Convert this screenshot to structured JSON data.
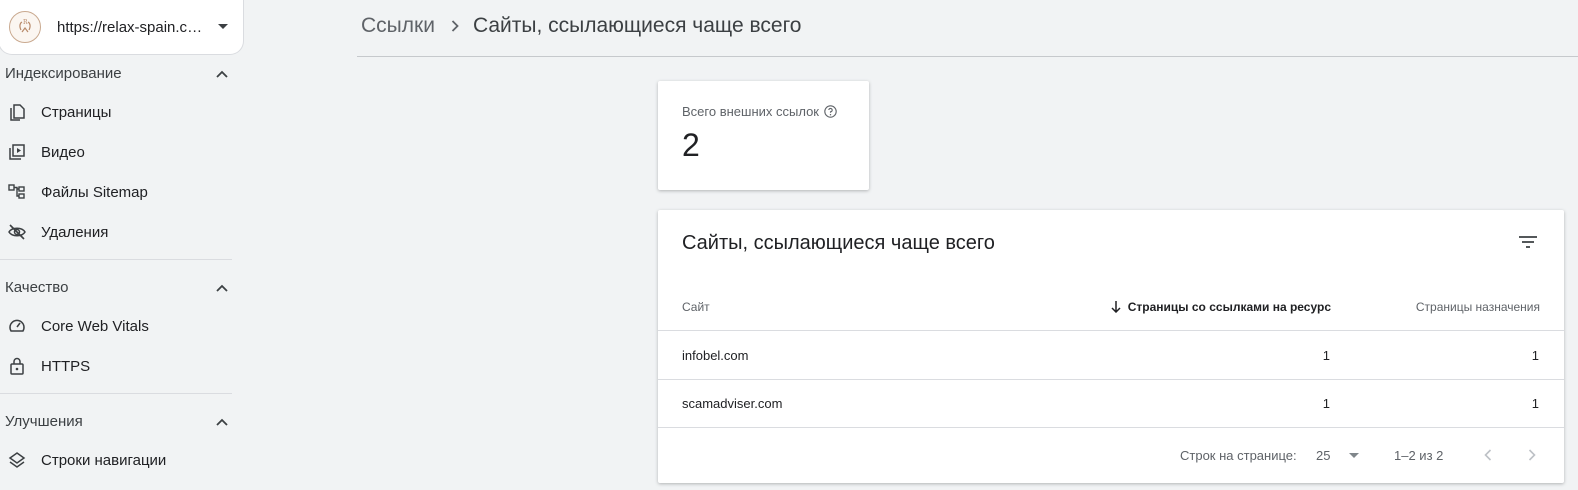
{
  "property": {
    "url": "https://relax-spain.co..."
  },
  "sidebar": {
    "sections": [
      {
        "title": "Индексирование",
        "items": [
          {
            "label": "Страницы",
            "icon": "pages-icon"
          },
          {
            "label": "Видео",
            "icon": "video-icon"
          },
          {
            "label": "Файлы Sitemap",
            "icon": "sitemap-icon"
          },
          {
            "label": "Удаления",
            "icon": "removals-icon"
          }
        ]
      },
      {
        "title": "Качество",
        "items": [
          {
            "label": "Core Web Vitals",
            "icon": "speedometer-icon"
          },
          {
            "label": "HTTPS",
            "icon": "lock-icon"
          }
        ]
      },
      {
        "title": "Улучшения",
        "items": [
          {
            "label": "Строки навигации",
            "icon": "layers-icon"
          }
        ]
      }
    ]
  },
  "breadcrumb": {
    "parent": "Ссылки",
    "current": "Сайты, ссылающиеся чаще всего"
  },
  "metric": {
    "label": "Всего внешних ссылок",
    "value": "2"
  },
  "table": {
    "title": "Сайты, ссылающиеся чаще всего",
    "columns": [
      "Сайт",
      "Страницы со ссылками на ресурс",
      "Страницы назначения"
    ],
    "sorted_column": 1,
    "rows": [
      [
        "infobel.com",
        "1",
        "1"
      ],
      [
        "scamadviser.com",
        "1",
        "1"
      ]
    ],
    "footer": {
      "rows_label": "Строк на странице:",
      "rows_value": "25",
      "range": "1–2 из 2"
    }
  },
  "colors": {
    "background": "#f1f3f4",
    "card": "#ffffff",
    "text": "#202124",
    "muted": "#5f6368",
    "divider": "#dadce0"
  }
}
